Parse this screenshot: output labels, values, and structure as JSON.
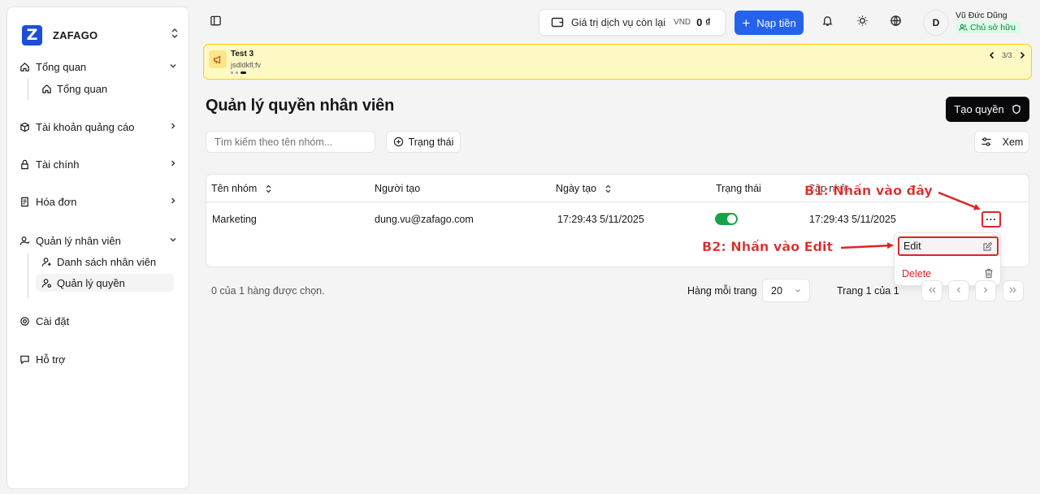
{
  "brand": {
    "name": "ZAFAGO",
    "logo_letter": "Z"
  },
  "sidebar": {
    "items": [
      {
        "label": "Tổng quan",
        "icon": "home-icon",
        "expanded": true
      },
      {
        "label": "Tài khoản quảng cáo",
        "icon": "box-icon",
        "expanded": false
      },
      {
        "label": "Tài chính",
        "icon": "wallet-icon",
        "expanded": false
      },
      {
        "label": "Hóa đơn",
        "icon": "receipt-icon",
        "expanded": false
      },
      {
        "label": "Quản lý nhân viên",
        "icon": "user-icon",
        "expanded": true
      },
      {
        "label": "Cài đặt",
        "icon": "gear-icon"
      },
      {
        "label": "Hỗ trợ",
        "icon": "chat-icon"
      }
    ],
    "sub_overview": {
      "label": "Tổng quan"
    },
    "sub_staff_list": {
      "label": "Danh sách nhân viên"
    },
    "sub_permissions": {
      "label": "Quản lý quyền",
      "active": true
    }
  },
  "header": {
    "balance_label": "Giá trị dịch vụ còn lại",
    "currency": "VND",
    "amount": "0 ₫",
    "topup_label": "Nạp tiền",
    "user_initial": "D",
    "user_name": "Vũ Đức Dũng",
    "user_role": "Chủ sở hữu",
    "accent_color": "#2563eb"
  },
  "banner": {
    "title": "Test 3",
    "description": "jsdldkfl;fv",
    "counter": "3/3",
    "active_dot": 3
  },
  "page": {
    "title": "Quản lý quyền nhân viên",
    "create_label": "Tạo quyền",
    "search_placeholder": "Tìm kiếm theo tên nhóm...",
    "status_filter_label": "Trạng thái",
    "view_label": "Xem"
  },
  "table": {
    "columns": {
      "group_name": "Tên nhóm",
      "creator": "Người tạo",
      "created_at": "Ngày tạo",
      "status": "Trạng thái",
      "updated_at": "Cập nhật"
    },
    "rows": [
      {
        "group_name": "Marketing",
        "creator": "dung.vu@zafago.com",
        "created_at": "17:29:43 5/11/2025",
        "status_enabled": true,
        "updated_at": "17:29:43 5/11/2025"
      }
    ]
  },
  "row_menu": {
    "edit_label": "Edit",
    "delete_label": "Delete"
  },
  "footer": {
    "selected_info": "0 của 1 hàng được chọn.",
    "rows_per_page_label": "Hàng mỗi trang",
    "rows_per_page_value": "20",
    "page_label": "Trang 1 của 1"
  },
  "annotations": {
    "step1": "B1: Nhấn vào đây",
    "step2": "B2: Nhấn vào Edit",
    "color": "#dc2626"
  }
}
